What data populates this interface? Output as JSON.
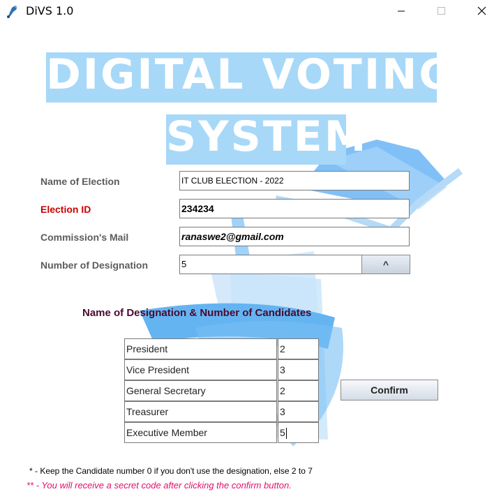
{
  "window": {
    "title": "DiVS 1.0",
    "controls": [
      "minimize",
      "maximize",
      "close"
    ]
  },
  "banner": {
    "line1": "DIGITAL VOTING",
    "line2": "SYSTEM",
    "bg_color": "#a7d8f8"
  },
  "form": {
    "election_name": {
      "label": "Name of Election",
      "value": "IT CLUB ELECTION - 2022"
    },
    "election_id": {
      "label": "Election ID",
      "value": "234234"
    },
    "commission_mail": {
      "label": "Commission's Mail",
      "value": "ranaswe2@gmail.com"
    },
    "designation_count": {
      "label": "Number of Designation",
      "value": "5",
      "spin_label": "^"
    }
  },
  "designations": {
    "title": "Name of Designation & Number of Candidates",
    "rows": [
      {
        "name": "President",
        "count": "2"
      },
      {
        "name": "Vice President",
        "count": "3"
      },
      {
        "name": "General Secretary",
        "count": "2"
      },
      {
        "name": "Treasurer",
        "count": "3"
      },
      {
        "name": "Executive Member",
        "count": "5"
      }
    ]
  },
  "actions": {
    "confirm_label": "Confirm"
  },
  "notes": {
    "note1": "*  -  Keep the Candidate number 0 if you don't use the designation, else 2 to 7",
    "note2": "** - You will receive a secret code after clicking the confirm button."
  },
  "colors": {
    "accent_red": "#cc0000",
    "note_pink": "#e0106c",
    "section_title": "#4a0a2e"
  }
}
